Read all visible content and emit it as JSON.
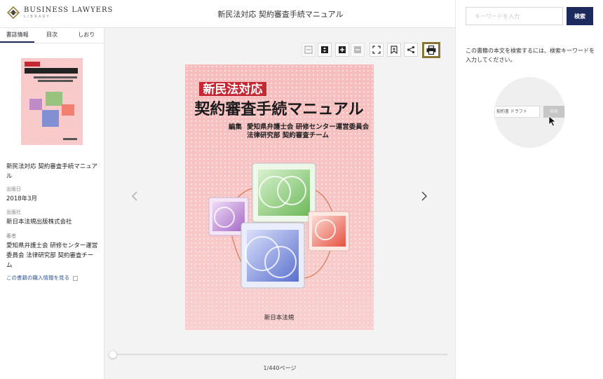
{
  "header": {
    "logo_name": "BUSINESS LAWYERS",
    "logo_sub": "LIBRARY",
    "title": "新民法対応 契約審査手続マニュアル"
  },
  "sidebar": {
    "tabs": [
      {
        "label": "書誌情報",
        "active": true
      },
      {
        "label": "目次",
        "active": false
      },
      {
        "label": "しおり",
        "active": false
      }
    ],
    "book_title": "新民法対応 契約審査手続マニュアル",
    "published_label": "出版日",
    "published_value": "2018年3月",
    "publisher_label": "出版社",
    "publisher_value": "新日本法規出版株式会社",
    "author_label": "著者",
    "author_value": "愛知県弁護士会 研修センター運営委員会 法律研究部 契約審査チーム",
    "purchase_link": "この書籍の購入情報を見る"
  },
  "viewer": {
    "toolbar": [
      {
        "name": "fit-width-icon",
        "enabled": false
      },
      {
        "name": "fit-height-icon",
        "enabled": true
      },
      {
        "name": "zoom-in-icon",
        "enabled": true
      },
      {
        "name": "zoom-out-icon",
        "enabled": false
      },
      {
        "name": "fullscreen-icon",
        "enabled": true
      },
      {
        "name": "bookmark-add-icon",
        "enabled": true
      },
      {
        "name": "share-icon",
        "enabled": true
      },
      {
        "name": "print-icon",
        "enabled": true
      }
    ],
    "cover": {
      "badge": "新民法対応",
      "title": "契約審査手続マニュアル",
      "editor_prefix": "編集",
      "editor_line1": "愛知県弁護士会 研修センター運営委員会",
      "editor_line2": "法律研究部 契約審査チーム",
      "publisher": "新日本法規"
    },
    "page_indicator": "1/440ページ",
    "slider_progress": 0.0
  },
  "search": {
    "placeholder": "キーワードを入力",
    "button_label": "検索",
    "help_text": "この書籍の本文を検索するには、検索キーワードを入力してください。",
    "demo_input_text": "契約書 ドラフト",
    "demo_button_label": "検索"
  },
  "colors": {
    "brand_navy": "#1d2a5e",
    "cover_red": "#c62833",
    "print_highlight": "#8a7434",
    "link_blue": "#2f5597"
  }
}
